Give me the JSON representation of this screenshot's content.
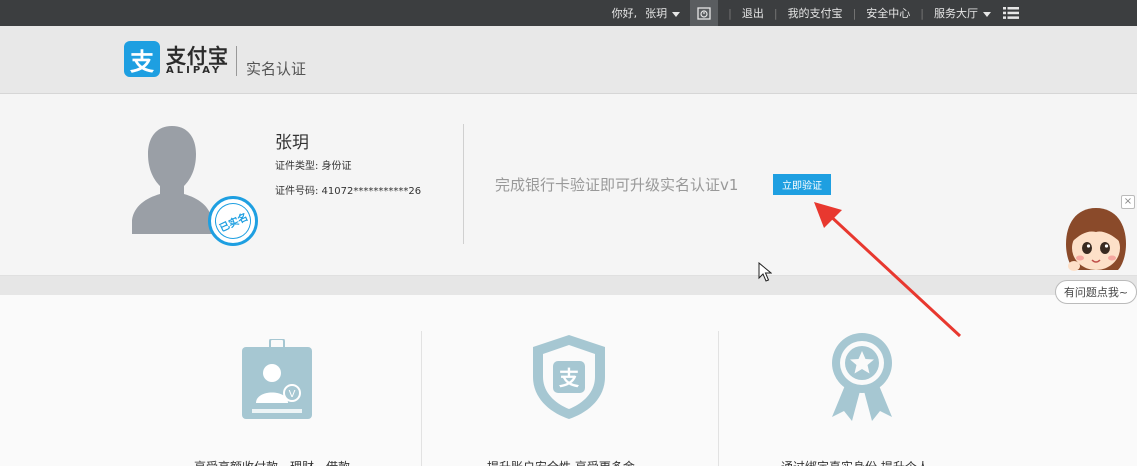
{
  "topbar": {
    "greeting": "你好,",
    "username": "张玥",
    "logout": "退出",
    "my_alipay": "我的支付宝",
    "security_center": "安全中心",
    "service_hall": "服务大厅"
  },
  "header": {
    "logo_cn": "支付宝",
    "logo_en": "ALIPAY",
    "logo_glyph": "支",
    "page_title": "实名认证"
  },
  "profile": {
    "name": "张玥",
    "id_type": "证件类型: 身份证",
    "id_number": "证件号码: 41072***********26",
    "stamp": "已实名",
    "upgrade_text": "完成银行卡验证即可升级实名认证v1",
    "verify_button": "立即验证"
  },
  "features": [
    {
      "text": "享受高额收付款、理财、借款",
      "icon": "id-badge-icon"
    },
    {
      "text": "提升账户安全性,享受更多金",
      "icon": "shield-icon"
    },
    {
      "text": "通过绑定真实身份,提升个人",
      "icon": "award-ribbon-icon"
    }
  ],
  "helper": {
    "bubble": "有问题点我~",
    "close": "×"
  },
  "colors": {
    "brand": "#1e9fe1",
    "topbar": "#3c3e40",
    "arrow": "#e8382f"
  }
}
